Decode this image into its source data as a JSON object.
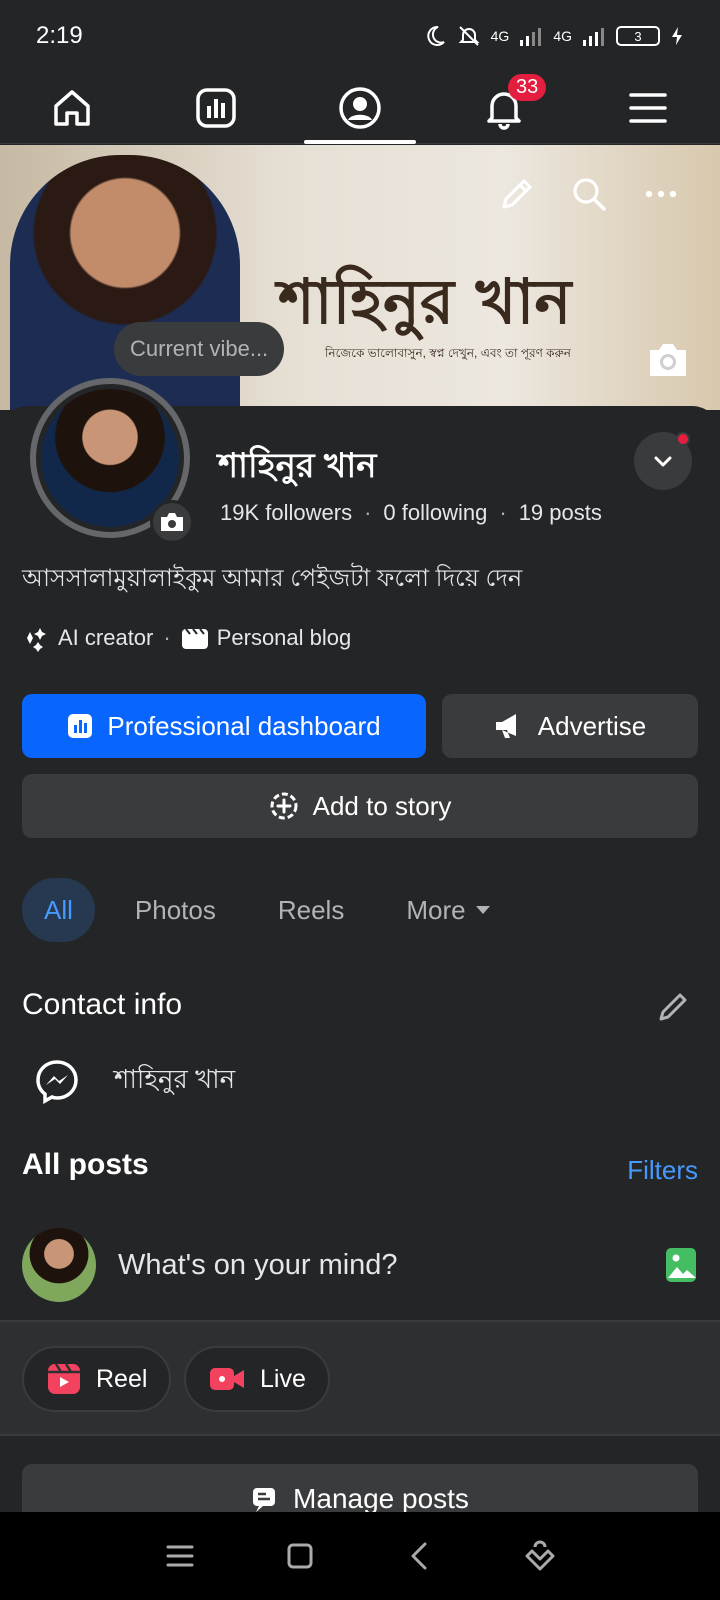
{
  "status_bar": {
    "time": "2:19",
    "network_1": "4G",
    "network_2": "4G",
    "battery": "3"
  },
  "nav": {
    "notifications_count": "33"
  },
  "cover": {
    "title": "শাহিনুর খান",
    "subtitle": "নিজেকে ভালোবাসুন, স্বপ্ন দেখুন, এবং তা পূরণ করুন"
  },
  "vibe": {
    "placeholder": "Current vibe..."
  },
  "profile": {
    "name": "শাহিনুর খান",
    "followers": "19K followers",
    "following": "0 following",
    "posts": "19 posts",
    "bio": "আসসালামুয়ালাইকুম আমার পেইজটা ফলো দিয়ে দেন",
    "tag_1": "AI creator",
    "tag_2": "Personal blog"
  },
  "actions": {
    "dashboard": "Professional dashboard",
    "advertise": "Advertise",
    "story": "Add to story"
  },
  "filters": {
    "all": "All",
    "photos": "Photos",
    "reels": "Reels",
    "more": "More"
  },
  "contact": {
    "title": "Contact info",
    "messenger_name": "শাহিনুর খান"
  },
  "posts": {
    "title": "All posts",
    "filters_link": "Filters",
    "composer_placeholder": "What's on your mind?",
    "reel": "Reel",
    "live": "Live",
    "manage": "Manage posts"
  },
  "colors": {
    "primary": "#0866ff",
    "background": "#242527",
    "surface": "#3a3b3c",
    "badge": "#e41e3f",
    "link": "#4599ff"
  }
}
